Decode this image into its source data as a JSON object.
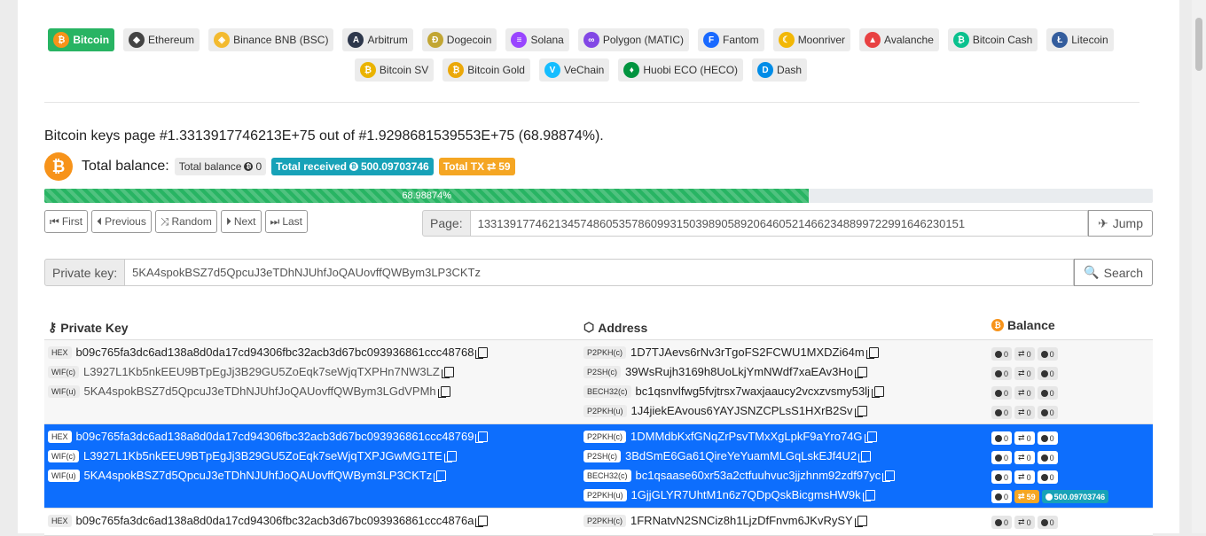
{
  "coins_row1": [
    {
      "label": "Bitcoin",
      "icon": "bitcoin-icon",
      "color": "#f7931a",
      "glyph": "₿",
      "active": true
    },
    {
      "label": "Ethereum",
      "icon": "ethereum-icon",
      "color": "#444444",
      "glyph": "◆"
    },
    {
      "label": "Binance BNB (BSC)",
      "icon": "binance-icon",
      "color": "#f3ba2f",
      "glyph": "◈"
    },
    {
      "label": "Arbitrum",
      "icon": "arbitrum-icon",
      "color": "#2d374b",
      "glyph": "A"
    },
    {
      "label": "Dogecoin",
      "icon": "dogecoin-icon",
      "color": "#c2a633",
      "glyph": "Ð"
    },
    {
      "label": "Solana",
      "icon": "solana-icon",
      "color": "#9945ff",
      "glyph": "≡"
    },
    {
      "label": "Polygon (MATIC)",
      "icon": "polygon-icon",
      "color": "#8247e5",
      "glyph": "∞"
    },
    {
      "label": "Fantom",
      "icon": "fantom-icon",
      "color": "#1969ff",
      "glyph": "F"
    },
    {
      "label": "Moonriver",
      "icon": "moonriver-icon",
      "color": "#f2b705",
      "glyph": "☾"
    },
    {
      "label": "Avalanche",
      "icon": "avalanche-icon",
      "color": "#e84142",
      "glyph": "▲"
    },
    {
      "label": "Bitcoin Cash",
      "icon": "bitcoin-cash-icon",
      "color": "#0ac18e",
      "glyph": "₿"
    },
    {
      "label": "Litecoin",
      "icon": "litecoin-icon",
      "color": "#345d9d",
      "glyph": "Ł"
    }
  ],
  "coins_row2": [
    {
      "label": "Bitcoin SV",
      "icon": "bitcoin-sv-icon",
      "color": "#eab300",
      "glyph": "₿"
    },
    {
      "label": "Bitcoin Gold",
      "icon": "bitcoin-gold-icon",
      "color": "#eba809",
      "glyph": "₿"
    },
    {
      "label": "VeChain",
      "icon": "vechain-icon",
      "color": "#15bdff",
      "glyph": "V"
    },
    {
      "label": "Huobi ECO (HECO)",
      "icon": "heco-icon",
      "color": "#01943f",
      "glyph": "♦"
    },
    {
      "label": "Dash",
      "icon": "dash-icon",
      "color": "#008ce7",
      "glyph": "D"
    }
  ],
  "page_info": "Bitcoin keys page #1.3313917746213E+75 out of #1.9298681539553E+75 (68.98874%).",
  "balance": {
    "label": "Total balance:",
    "total_balance_label": "Total balance",
    "total_balance_value": "0",
    "total_received_label": "Total received",
    "total_received_value": "500.09703746",
    "total_tx_label": "Total TX",
    "total_tx_value": "59"
  },
  "progress": {
    "label": "68.98874%",
    "percent": 68.98874
  },
  "nav": {
    "first": "First",
    "previous": "Previous",
    "random": "Random",
    "next": "Next",
    "last": "Last"
  },
  "page_field": {
    "label": "Page:",
    "value": "1331391774621345748605357860993150398905892064605214662348899722991646230151",
    "button": "Jump"
  },
  "private_key_field": {
    "label": "Private key:",
    "value": "5KA4spokBSZ7d5QpcuJ3eTDhNJUhfJoQAUovffQWBym3LP3CKTz",
    "button": "Search"
  },
  "table": {
    "col_private_key": "Private Key",
    "col_address": "Address",
    "col_balance": "Balance",
    "rows": [
      {
        "hex_tag": "HEX",
        "hex": "b09c765fa3dc6ad138a8d0da17cd94306fbc32acb3d67bc093936861ccc48768",
        "wifc_tag": "WIF(c)",
        "wifc": "L3927L1Kb5nkEEU9BTpEgJj3B29GU5ZoEqk7seWjqTXPHn7NW3LZ",
        "wifu_tag": "WIF(u)",
        "wifu": "5KA4spokBSZ7d5QpcuJ3eTDhNJUhfJoQAUovffQWBym3LGdVPMh",
        "addrs": [
          {
            "tag": "P2PKH(c)",
            "addr": "1D7TJAevs6rNv3rTgoFS2FCWU1MXDZi64m",
            "bal": "0",
            "tx": "0",
            "rec": "0"
          },
          {
            "tag": "P2SH(c)",
            "addr": "39WsRujh3169h8UoLkjYmNWdf7xaEAv3Ho",
            "bal": "0",
            "tx": "0",
            "rec": "0"
          },
          {
            "tag": "BECH32(c)",
            "addr": "bc1qsnvlfwg5fvjtrsx7waxjaaucy2vcxzvsmy53lj",
            "bal": "0",
            "tx": "0",
            "rec": "0"
          },
          {
            "tag": "P2PKH(u)",
            "addr": "1J4jiekEAvous6YAYJSNZCPLsS1HXrB2Sv",
            "bal": "0",
            "tx": "0",
            "rec": "0"
          }
        ]
      },
      {
        "hex_tag": "HEX",
        "hex": "b09c765fa3dc6ad138a8d0da17cd94306fbc32acb3d67bc093936861ccc48769",
        "wifc_tag": "WIF(c)",
        "wifc": "L3927L1Kb5nkEEU9BTpEgJj3B29GU5ZoEqk7seWjqTXPJGwMG1TE",
        "wifu_tag": "WIF(u)",
        "wifu": "5KA4spokBSZ7d5QpcuJ3eTDhNJUhfJoQAUovffQWBym3LP3CKTz",
        "addrs": [
          {
            "tag": "P2PKH(c)",
            "addr": "1DMMdbKxfGNqZrPsvTMxXgLpkF9aYro74G",
            "bal": "0",
            "tx": "0",
            "rec": "0"
          },
          {
            "tag": "P2SH(c)",
            "addr": "3BdSmE6Ga61QireYeYuamMLGqLskEJf4U2",
            "bal": "0",
            "tx": "0",
            "rec": "0"
          },
          {
            "tag": "BECH32(c)",
            "addr": "bc1qsaase60xr53a2ctfuuhvuc3jjzhnm92zdf97yc",
            "bal": "0",
            "tx": "0",
            "rec": "0"
          },
          {
            "tag": "P2PKH(u)",
            "addr": "1GjjGLYR7UhtM1n6z7QDpQskBicgmsHW9k",
            "bal": "0",
            "tx": "59",
            "rec": "500.09703746"
          }
        ]
      },
      {
        "hex_tag": "HEX",
        "hex": "b09c765fa3dc6ad138a8d0da17cd94306fbc32acb3d67bc093936861ccc4876a",
        "addrs": [
          {
            "tag": "P2PKH(c)",
            "addr": "1FRNatvN2SNCiz8h1LjzDfFnvm6JKvRySY",
            "bal": "0",
            "tx": "0",
            "rec": "0"
          }
        ]
      }
    ]
  },
  "colors": {
    "green": "#28b463",
    "blue": "#0d6efd",
    "cyan": "#17a2b8",
    "orange": "#f5a623",
    "bitcoin": "#f7931a"
  }
}
